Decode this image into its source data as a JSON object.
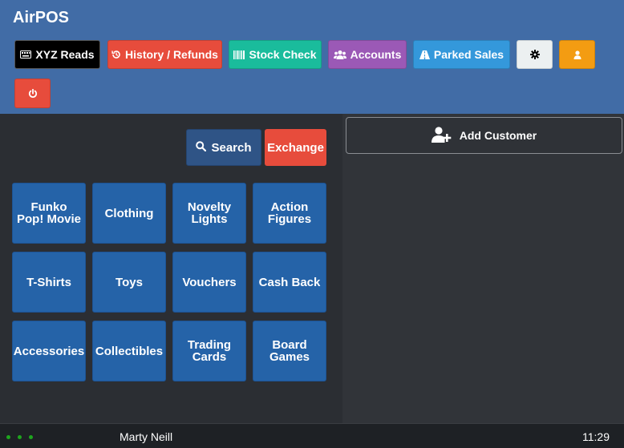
{
  "app": {
    "title": "AirPOS"
  },
  "toolbar": {
    "xyz_reads": "XYZ Reads",
    "history_refunds": "History / Refunds",
    "stock_check": "Stock Check",
    "accounts": "Accounts",
    "parked_sales": "Parked Sales",
    "icons": {
      "xyz": "keyboard-icon",
      "history": "history-icon",
      "stock": "barcode-icon",
      "accounts": "users-icon",
      "parked": "road-icon",
      "settings": "gear-icon",
      "user": "user-icon",
      "power": "power-icon"
    }
  },
  "actions": {
    "search": "Search",
    "exchange": "Exchange"
  },
  "categories": [
    "Funko\nPop! Movie",
    "Clothing",
    "Novelty\nLights",
    "Action\nFigures",
    "T-Shirts",
    "Toys",
    "Vouchers",
    "Cash Back",
    "Accessories",
    "Collectibles",
    "Trading\nCards",
    "Board\nGames"
  ],
  "customer": {
    "add_label": "Add Customer"
  },
  "footer": {
    "user": "Marty Neill",
    "time": "11:29"
  },
  "colors": {
    "header": "#416ca6",
    "xyz": "#000000",
    "history": "#e74c3c",
    "stock": "#1abc9c",
    "accounts": "#9b59b6",
    "parked": "#3498db",
    "settings": "#ecf0f1",
    "user": "#f39c12",
    "power": "#e74c3c",
    "category": "#2563a8"
  }
}
